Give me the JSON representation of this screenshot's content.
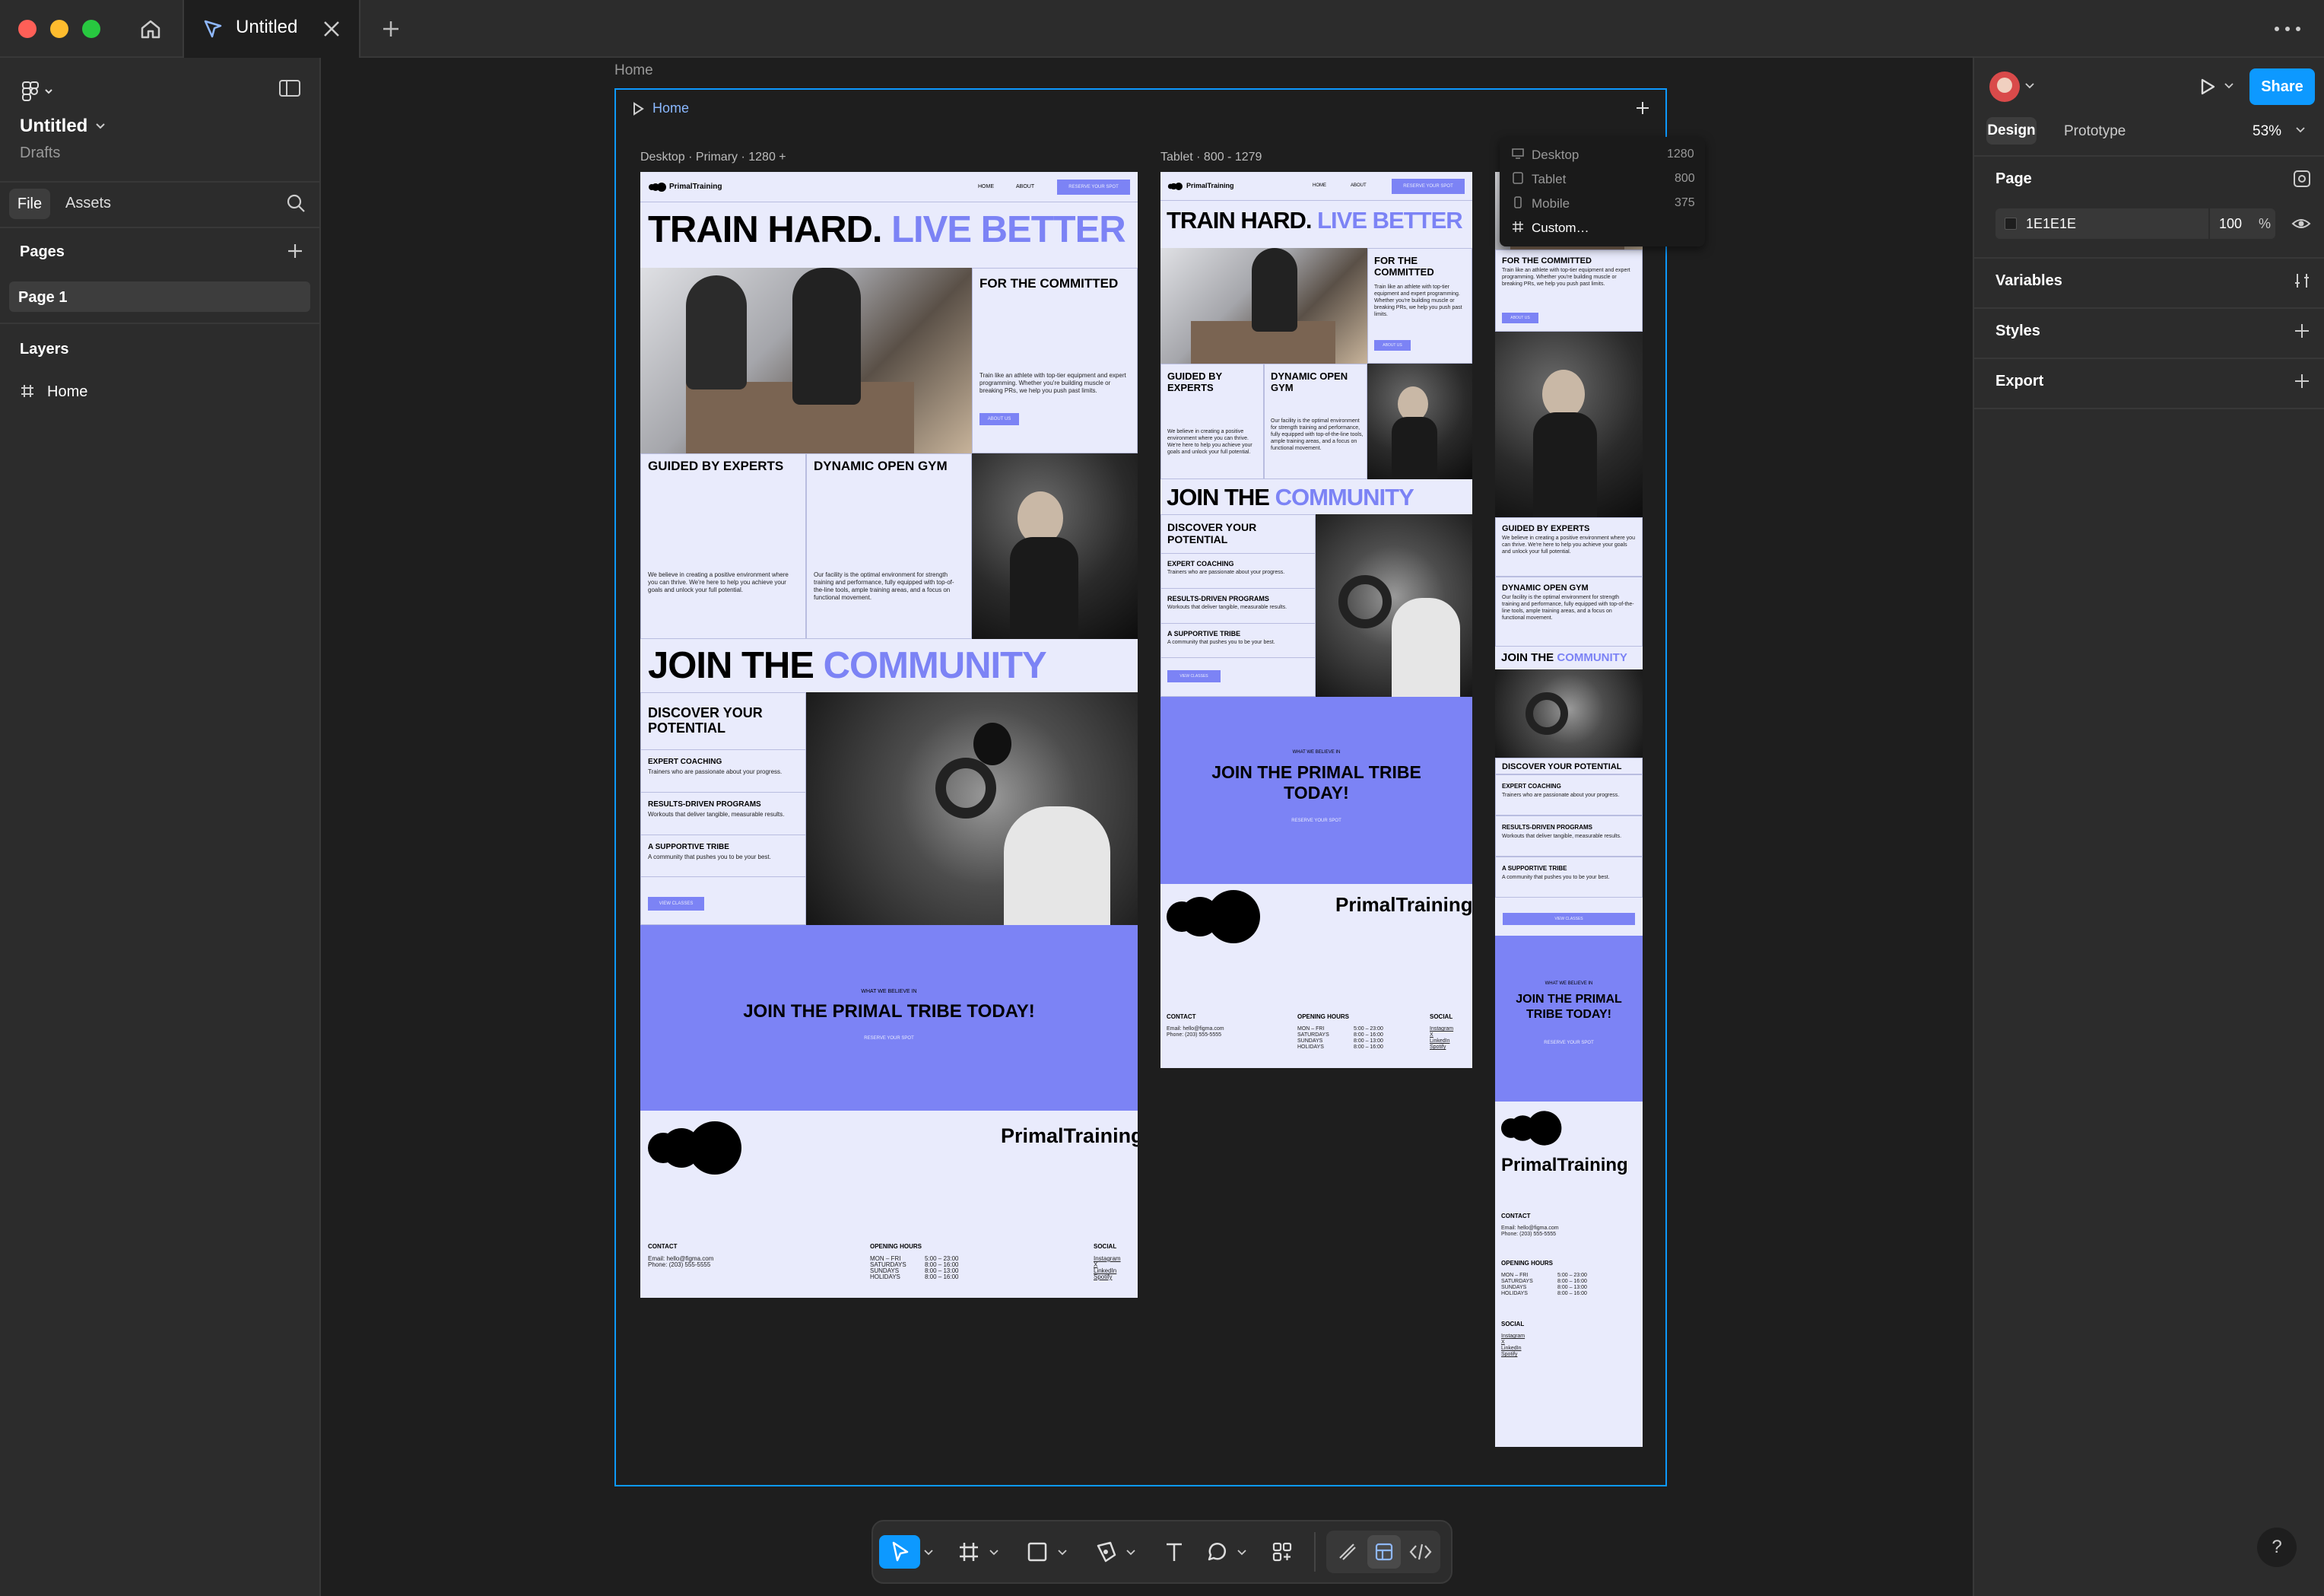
{
  "app": {
    "tab_title": "Untitled"
  },
  "left_panel": {
    "file_name": "Untitled",
    "location": "Drafts",
    "tabs": [
      "File",
      "Assets"
    ],
    "pages_label": "Pages",
    "pages": [
      "Page 1"
    ],
    "layers_label": "Layers",
    "layers": [
      "Home"
    ]
  },
  "canvas": {
    "frame_label": "Home",
    "flow_label": "Home",
    "desktop_label": "Desktop · Primary · 1280 +",
    "tablet_label": "Tablet · 800 - 1279",
    "breakpoints": [
      {
        "name": "Desktop",
        "size": "1280"
      },
      {
        "name": "Tablet",
        "size": "800"
      },
      {
        "name": "Mobile",
        "size": "375"
      },
      {
        "name": "Custom…",
        "size": ""
      }
    ]
  },
  "site": {
    "brand": "PrimalTraining",
    "nav": [
      "HOME",
      "ABOUT"
    ],
    "nav_cta": "RESERVE YOUR SPOT",
    "hero_a": "TRAIN HARD.",
    "hero_b": "LIVE BETTER",
    "committed_title": "FOR THE COMMITTED",
    "committed_text": "Train like an athlete with top-tier equipment and expert programming. Whether you're building muscle or breaking PRs, we help you push past limits.",
    "about_btn": "ABOUT US",
    "experts_title": "GUIDED BY EXPERTS",
    "experts_text": "We believe in creating a positive environment where you can thrive. We're here to help you achieve your goals and unlock your full potential.",
    "gym_title": "DYNAMIC OPEN GYM",
    "gym_text": "Our facility is the optimal environment for strength training and performance, fully equipped with top-of-the-line tools, ample training areas, and a focus on functional movement.",
    "join_a": "JOIN THE",
    "join_b": "COMMUNITY",
    "discover_title": "DISCOVER YOUR POTENTIAL",
    "features": [
      {
        "title": "EXPERT COACHING",
        "text": "Trainers who are passionate about your progress."
      },
      {
        "title": "RESULTS-DRIVEN PROGRAMS",
        "text": "Workouts that deliver tangible, measurable results."
      },
      {
        "title": "A SUPPORTIVE TRIBE",
        "text": "A community that pushes you to be your best."
      }
    ],
    "classes_btn": "VIEW CLASSES",
    "believe_label": "WHAT WE BELIEVE IN",
    "tribe_title": "JOIN THE PRIMAL TRIBE TODAY!",
    "reserve_link": "RESERVE YOUR SPOT",
    "contact_title": "CONTACT",
    "contact_lines": [
      "Email: hello@figma.com",
      "Phone: (203) 555-5555"
    ],
    "hours_title": "OPENING HOURS",
    "hours": [
      {
        "day": "MON – FRI",
        "time": "5:00 – 23:00"
      },
      {
        "day": "SATURDAYS",
        "time": "8:00 – 16:00"
      },
      {
        "day": "SUNDAYS",
        "time": "8:00 – 13:00"
      },
      {
        "day": "HOLIDAYS",
        "time": "8:00 – 16:00"
      }
    ],
    "social_title": "SOCIAL",
    "social": [
      "Instagram",
      "X",
      "LinkedIn",
      "Spotify"
    ]
  },
  "right_panel": {
    "tabs": [
      "Design",
      "Prototype"
    ],
    "zoom": "53%",
    "share_label": "Share",
    "page_label": "Page",
    "page_color": "1E1E1E",
    "opacity": "100",
    "opacity_unit": "%",
    "sections": [
      "Variables",
      "Styles",
      "Export"
    ]
  },
  "colors": {
    "accent": "#0d99ff",
    "brand_purple": "#7c83f5",
    "artboard_bg": "#e9ebfc"
  }
}
